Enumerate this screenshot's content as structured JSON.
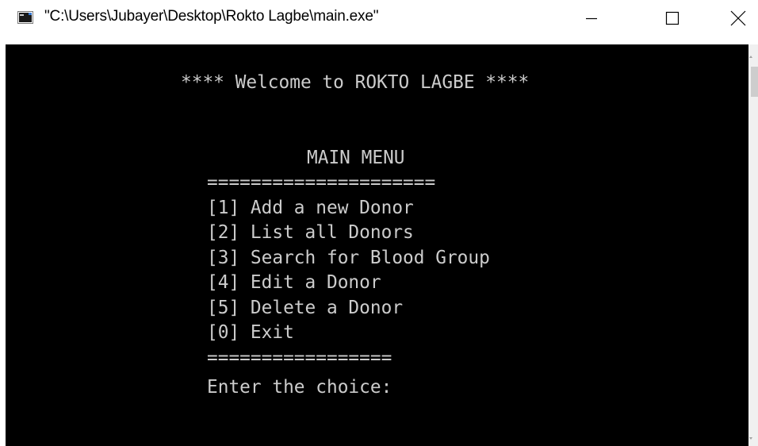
{
  "window": {
    "title": "\"C:\\Users\\Jubayer\\Desktop\\Rokto Lagbe\\main.exe\"",
    "controls": {
      "minimize": "minimize-icon",
      "maximize": "maximize-icon",
      "close": "close-icon"
    }
  },
  "console": {
    "welcome": "**** Welcome to ROKTO LAGBE ****",
    "menu_title": "MAIN MENU",
    "divider_top": "=====================",
    "options": [
      "[1] Add a new Donor",
      "[2] List all Donors",
      "[3] Search for Blood Group",
      "[4] Edit a Donor",
      "[5] Delete a Donor",
      "[0] Exit"
    ],
    "divider_bottom": "=================",
    "prompt": "Enter the choice:"
  },
  "colors": {
    "console_background": "#000000",
    "console_text": "#cccccc",
    "titlebar_background": "#ffffff"
  }
}
